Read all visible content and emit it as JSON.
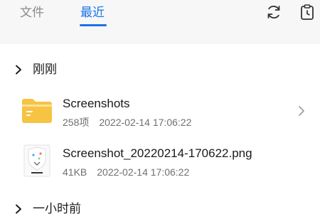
{
  "tabs": [
    {
      "label": "文件",
      "active": false
    },
    {
      "label": "最近",
      "active": true
    }
  ],
  "toolbar": {
    "refresh_icon": "refresh-icon",
    "history_icon": "clipboard-clock-icon"
  },
  "sections": [
    {
      "title": "刚刚",
      "items": [
        {
          "name": "Screenshots",
          "count": "258项",
          "datetime": "2022-02-14 17:06:22",
          "icon": "folder-icon"
        },
        {
          "name": "Screenshot_20220214-170622.png",
          "size": "41KB",
          "datetime": "2022-02-14 17:06:22",
          "icon": "image-thumbnail"
        }
      ]
    },
    {
      "title": "一小时前"
    }
  ],
  "colors": {
    "accent": "#1a73e8",
    "folder": "#f6c343",
    "topbar_bg": "#f7f7f7"
  }
}
